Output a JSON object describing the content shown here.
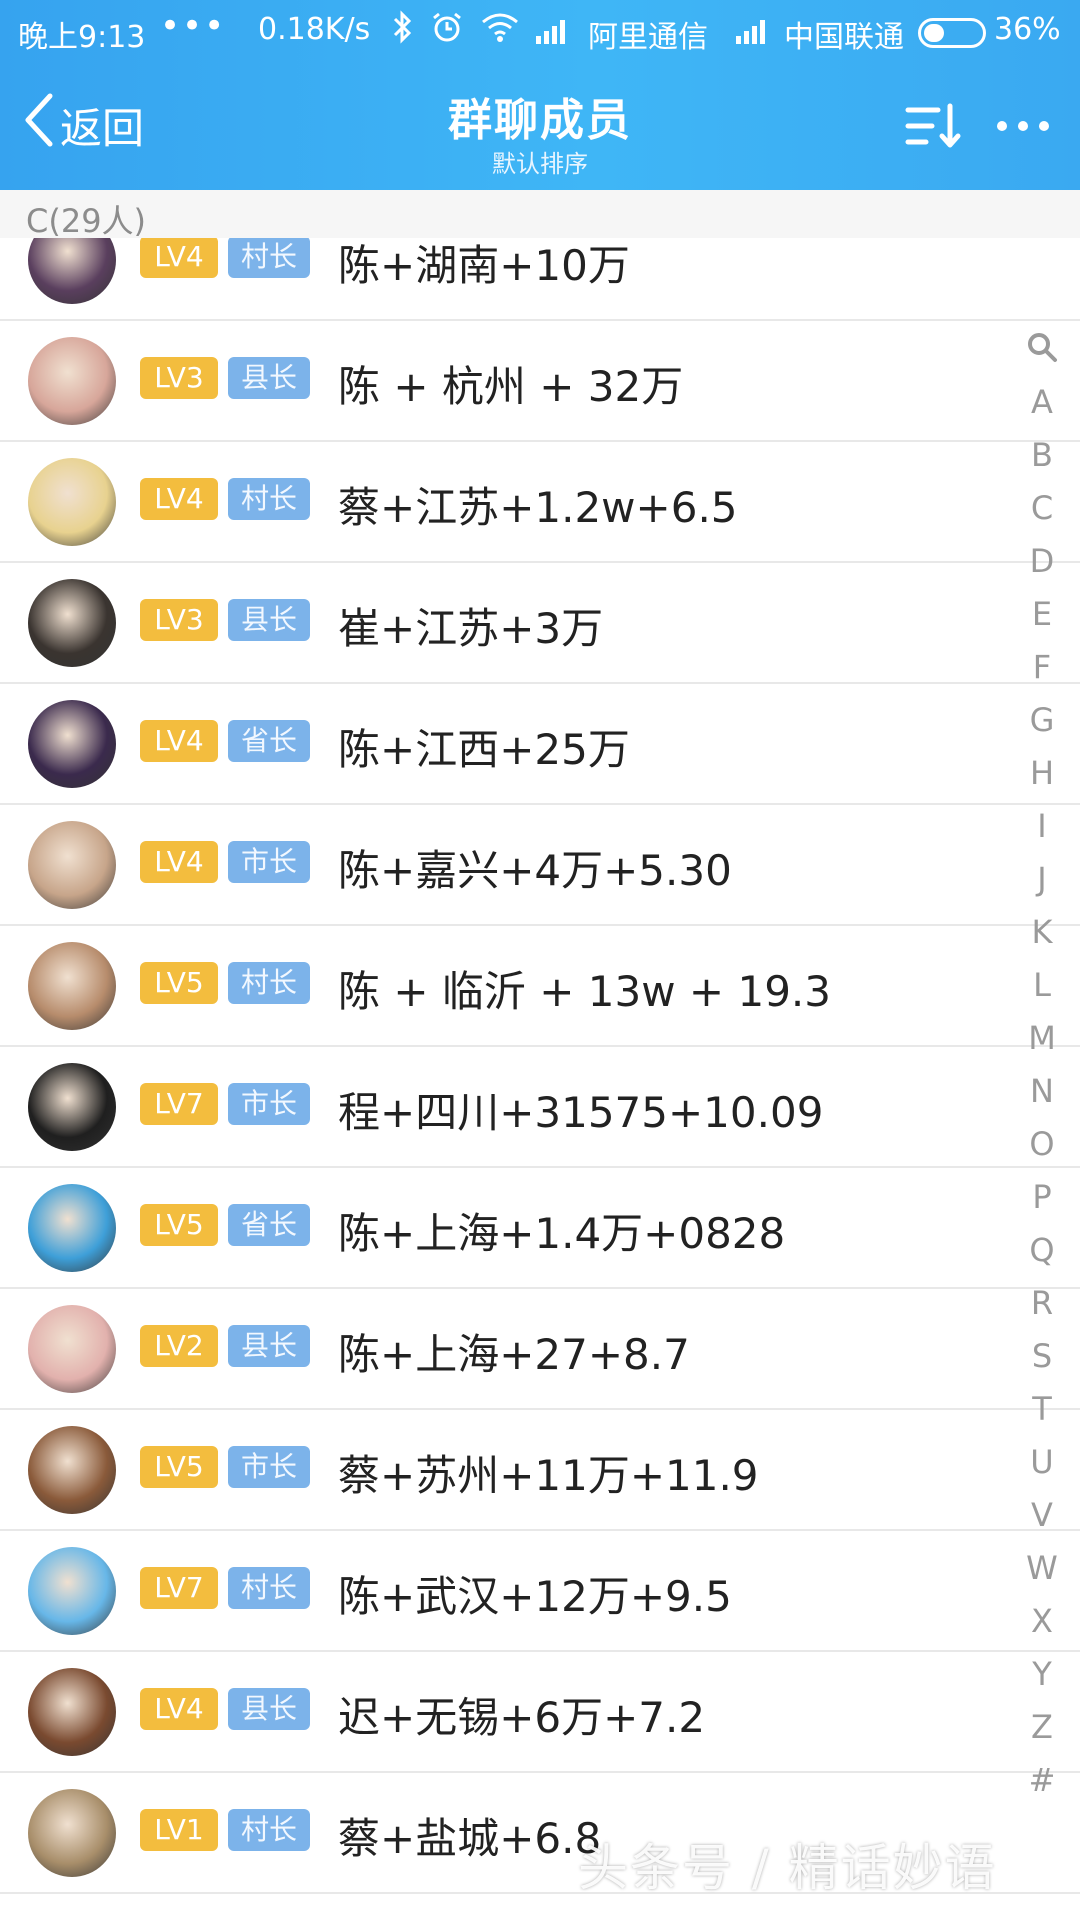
{
  "status_bar": {
    "time": "晚上9:13",
    "dots": "•••",
    "speed": "0.18K/s",
    "carrier1": "阿里通信",
    "carrier2": "中国联通",
    "battery_pct": "36%",
    "battery_level": 0.36
  },
  "header": {
    "back_label": "返回",
    "title": "群聊成员",
    "subtitle": "默认排序"
  },
  "section": {
    "label": "C(29人)"
  },
  "members": [
    {
      "level": "LV4",
      "title": "村长",
      "name": "陈+湖南+10万",
      "avatar_color": "#5a3f5e"
    },
    {
      "level": "LV3",
      "title": "县长",
      "name": "陈 + 杭州 + 32万",
      "avatar_color": "#d7a69a"
    },
    {
      "level": "LV4",
      "title": "村长",
      "name": "蔡+江苏+1.2w+6.5",
      "avatar_color": "#e8d28f"
    },
    {
      "level": "LV3",
      "title": "县长",
      "name": "崔+江苏+3万",
      "avatar_color": "#3a3430"
    },
    {
      "level": "LV4",
      "title": "省长",
      "name": "陈+江西+25万",
      "avatar_color": "#3b2a4d"
    },
    {
      "level": "LV4",
      "title": "市长",
      "name": "陈+嘉兴+4万+5.30",
      "avatar_color": "#c7a58a"
    },
    {
      "level": "LV5",
      "title": "村长",
      "name": "陈 + 临沂 + 13w + 19.3",
      "avatar_color": "#b78c6c"
    },
    {
      "level": "LV7",
      "title": "市长",
      "name": "程+四川+31575+10.09",
      "avatar_color": "#1f1f1f"
    },
    {
      "level": "LV5",
      "title": "省长",
      "name": "陈+上海+1.4万+0828",
      "avatar_color": "#3e9fd8"
    },
    {
      "level": "LV2",
      "title": "县长",
      "name": "陈+上海+27+8.7",
      "avatar_color": "#e2b1ad"
    },
    {
      "level": "LV5",
      "title": "市长",
      "name": "蔡+苏州+11万+11.9",
      "avatar_color": "#8a5a3a"
    },
    {
      "level": "LV7",
      "title": "村长",
      "name": "陈+武汉+12万+9.5",
      "avatar_color": "#67b7e8"
    },
    {
      "level": "LV4",
      "title": "县长",
      "name": "迟+无锡+6万+7.2",
      "avatar_color": "#7a4a30"
    },
    {
      "level": "LV1",
      "title": "村长",
      "name": "蔡+盐城+6.8",
      "avatar_color": "#a88e6a"
    }
  ],
  "index_letters": [
    "A",
    "B",
    "C",
    "D",
    "E",
    "F",
    "G",
    "H",
    "I",
    "J",
    "K",
    "L",
    "M",
    "N",
    "O",
    "P",
    "Q",
    "R",
    "S",
    "T",
    "U",
    "V",
    "W",
    "X",
    "Y",
    "Z",
    "#"
  ],
  "watermark": "头条号 / 精话妙语",
  "colors": {
    "header_blue": "#3aaef3",
    "level_badge": "#f3bd3e",
    "title_badge": "#7cb3ea"
  }
}
